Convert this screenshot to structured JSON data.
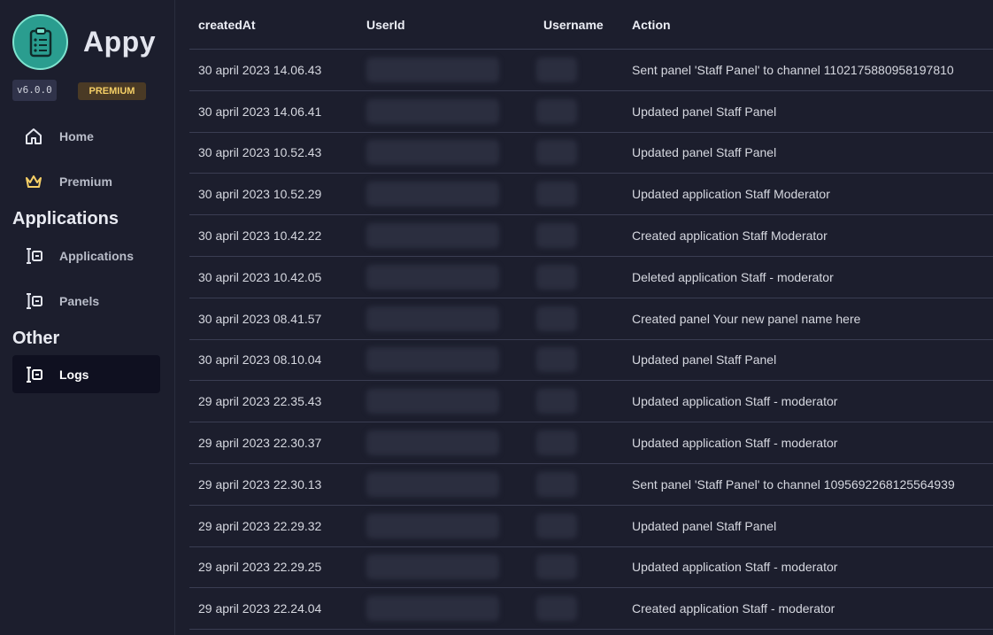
{
  "app": {
    "name": "Appy",
    "version": "v6.0.0",
    "badge": "PREMIUM",
    "logo_icon": "clipboard-check-icon",
    "accent": "#2a9d8f",
    "badge_color": "#f5cf66"
  },
  "sidebar": {
    "items": [
      {
        "label": "Home",
        "icon": "home-icon"
      },
      {
        "label": "Premium",
        "icon": "crown-icon"
      }
    ],
    "sections": [
      {
        "title": "Applications",
        "items": [
          {
            "label": "Applications",
            "icon": "form-icon"
          },
          {
            "label": "Panels",
            "icon": "form-icon"
          }
        ]
      },
      {
        "title": "Other",
        "items": [
          {
            "label": "Logs",
            "icon": "form-icon",
            "active": true
          }
        ]
      }
    ]
  },
  "logs": {
    "columns": [
      "createdAt",
      "UserId",
      "Username",
      "Action"
    ],
    "rows": [
      {
        "createdAt": "30 april 2023 14.06.43",
        "action": "Sent panel 'Staff Panel' to channel 1102175880958197810"
      },
      {
        "createdAt": "30 april 2023 14.06.41",
        "action": "Updated panel Staff Panel"
      },
      {
        "createdAt": "30 april 2023 10.52.43",
        "action": "Updated panel Staff Panel"
      },
      {
        "createdAt": "30 april 2023 10.52.29",
        "action": "Updated application Staff Moderator"
      },
      {
        "createdAt": "30 april 2023 10.42.22",
        "action": "Created application Staff Moderator"
      },
      {
        "createdAt": "30 april 2023 10.42.05",
        "action": "Deleted application Staff - moderator"
      },
      {
        "createdAt": "30 april 2023 08.41.57",
        "action": "Created panel Your new panel name here"
      },
      {
        "createdAt": "30 april 2023 08.10.04",
        "action": "Updated panel Staff Panel"
      },
      {
        "createdAt": "29 april 2023 22.35.43",
        "action": "Updated application Staff - moderator"
      },
      {
        "createdAt": "29 april 2023 22.30.37",
        "action": "Updated application Staff - moderator"
      },
      {
        "createdAt": "29 april 2023 22.30.13",
        "action": "Sent panel 'Staff Panel' to channel 1095692268125564939"
      },
      {
        "createdAt": "29 april 2023 22.29.32",
        "action": "Updated panel Staff Panel"
      },
      {
        "createdAt": "29 april 2023 22.29.25",
        "action": "Updated application Staff - moderator"
      },
      {
        "createdAt": "29 april 2023 22.24.04",
        "action": "Created application Staff - moderator"
      }
    ]
  }
}
